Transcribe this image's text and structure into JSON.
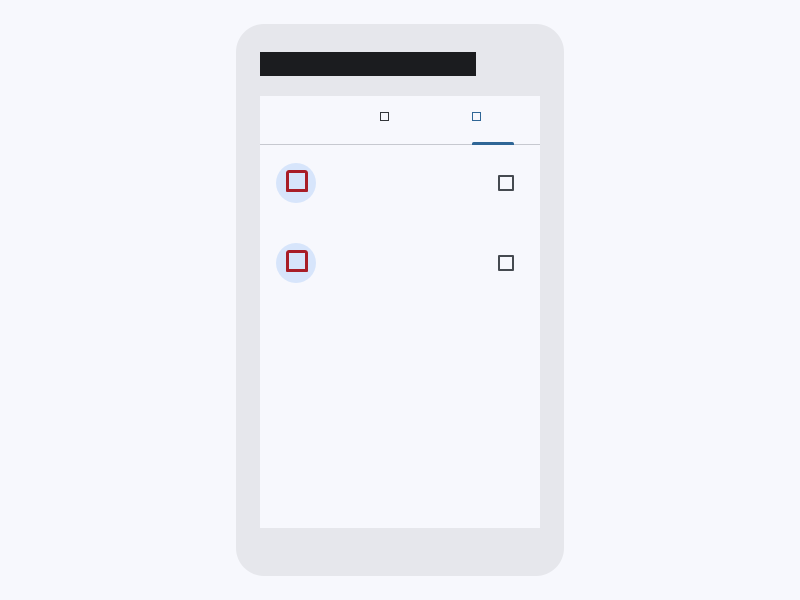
{
  "app": {
    "title": ""
  },
  "tabs": [
    {
      "label": "",
      "icon": "tab-icon",
      "active": false
    },
    {
      "label": "",
      "icon": "tab-icon",
      "active": false
    },
    {
      "label": "",
      "icon": "tab-icon",
      "active": true
    }
  ],
  "list": [
    {
      "title": "",
      "subtitle": "",
      "meta": "",
      "avatar_icon": "mark-icon",
      "action_icon": "checkbox-icon"
    },
    {
      "title": "",
      "subtitle": "",
      "meta": "",
      "avatar_icon": "mark-icon",
      "action_icon": "checkbox-icon"
    }
  ],
  "colors": {
    "background": "#f7f8fd",
    "device": "#e6e7ec",
    "title_bar": "#1b1c1f",
    "text": "#454a50",
    "accent": "#2f6696",
    "avatar_background": "#d7e5fb",
    "avatar_mark": "#a81d27"
  }
}
